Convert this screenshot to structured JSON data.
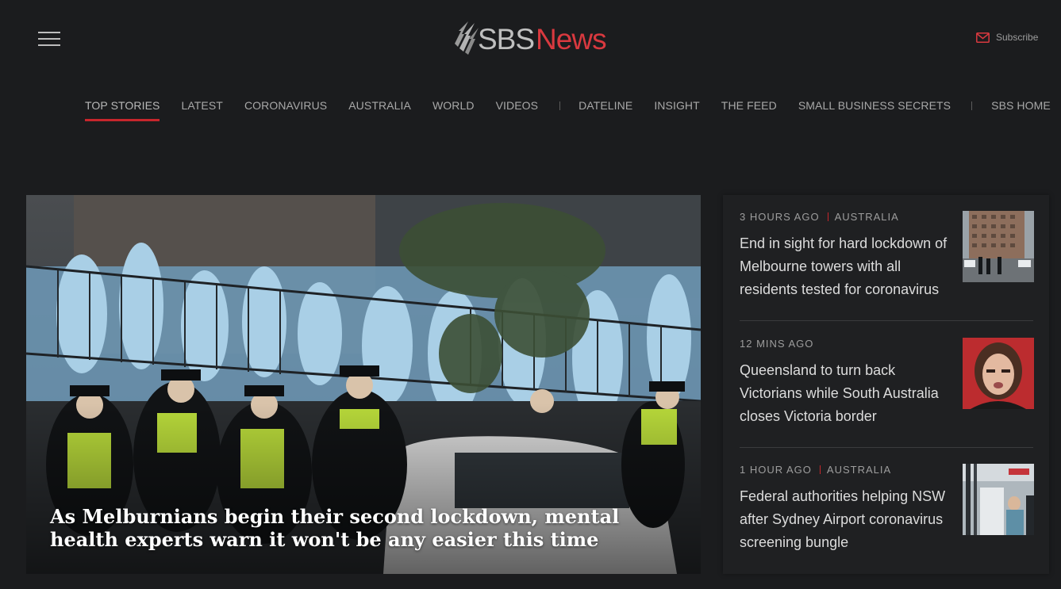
{
  "header": {
    "logo_sbs": "SBS",
    "logo_news": "News",
    "subscribe_label": "Subscribe",
    "brand_color": "#d9393f"
  },
  "nav": {
    "items": [
      "TOP STORIES",
      "LATEST",
      "CORONAVIRUS",
      "AUSTRALIA",
      "WORLD",
      "VIDEOS",
      "DATELINE",
      "INSIGHT",
      "THE FEED",
      "SMALL BUSINESS SECRETS",
      "SBS HOME"
    ],
    "active": "TOP STORIES"
  },
  "hero": {
    "headline": "As Melburnians begin their second lockdown, mental health experts warn it won't be any easier this time"
  },
  "stories": [
    {
      "time": "3 HOURS AGO",
      "category": "AUSTRALIA",
      "title": "End in sight for hard lockdown of Melbourne towers with all residents tested for coronavirus",
      "thumb_icon": "tower-photo"
    },
    {
      "time": "12 MINS AGO",
      "category": "",
      "title": "Queensland to turn back Victorians while South Australia closes Victoria border",
      "thumb_icon": "portrait-photo"
    },
    {
      "time": "1 HOUR AGO",
      "category": "AUSTRALIA",
      "title": "Federal authorities helping NSW after Sydney Airport coronavirus screening bungle",
      "thumb_icon": "airport-photo"
    }
  ]
}
